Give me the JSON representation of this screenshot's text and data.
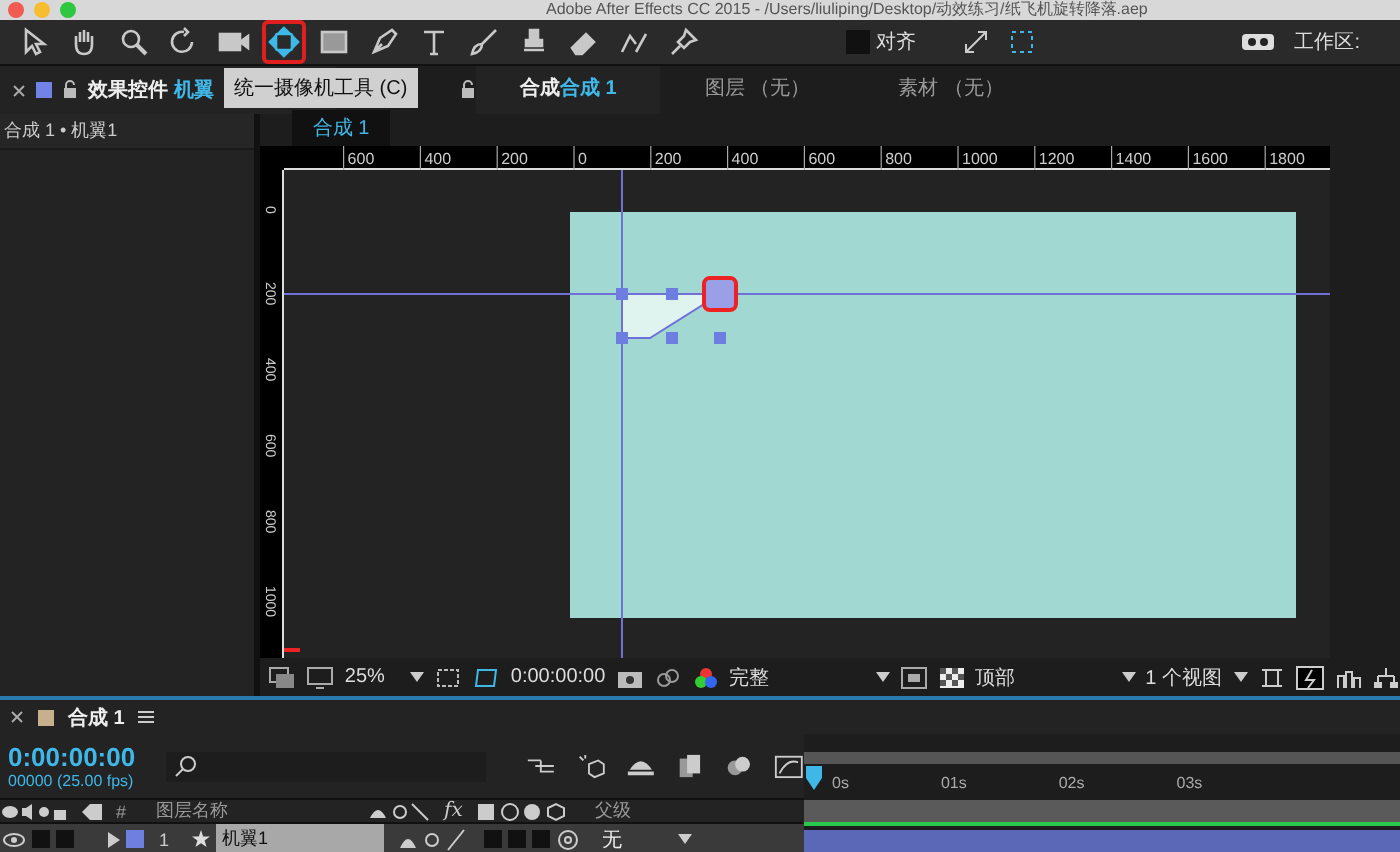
{
  "window": {
    "title": "Adobe After Effects CC 2015 - /Users/liuliping/Desktop/动效练习/纸飞机旋转降落.aep"
  },
  "toolbar": {
    "tools": [
      {
        "kind": "arrow",
        "selected": false
      },
      {
        "kind": "hand",
        "selected": false
      },
      {
        "kind": "zoom",
        "selected": false
      },
      {
        "kind": "rotate",
        "selected": false
      },
      {
        "kind": "camera",
        "selected": false
      },
      {
        "kind": "orbit",
        "selected": true
      },
      {
        "kind": "rect",
        "selected": false
      },
      {
        "kind": "pen",
        "selected": false
      },
      {
        "kind": "text",
        "selected": false
      },
      {
        "kind": "brush",
        "selected": false
      },
      {
        "kind": "stamp",
        "selected": false
      },
      {
        "kind": "eraser",
        "selected": false
      },
      {
        "kind": "roto",
        "selected": false
      },
      {
        "kind": "pin",
        "selected": false
      }
    ],
    "tooltip": "统一摄像机工具 (C)",
    "align_label": "对齐",
    "align_checked": false,
    "workspace_label": "工作区:"
  },
  "left_panel": {
    "tab_label": "效果控件",
    "tab_target": "机翼",
    "breadcrumb": "合成 1 • 机翼1"
  },
  "viewer_tabs": [
    {
      "label": "合成",
      "target": "合成 1",
      "selected": true
    },
    {
      "label": "图层 （无）",
      "selected": false
    },
    {
      "label": "素材 （无）",
      "selected": false
    }
  ],
  "comp_tab": "合成 1",
  "ruler": {
    "horizontal": [
      "600",
      "400",
      "200",
      "0",
      "200",
      "400",
      "600",
      "800",
      "1000",
      "1200",
      "1400",
      "1600",
      "1800"
    ],
    "vertical": [
      "0",
      "200",
      "400",
      "600",
      "800",
      "1000"
    ]
  },
  "viewer_bar": {
    "zoom": "25%",
    "time": "0:00:00:00",
    "resolution": "完整",
    "view": "顶部",
    "layout": "1 个视图"
  },
  "timeline": {
    "tab": "合成 1",
    "timecode": "0:00:00:00",
    "frames": "00000 (25.00 fps)",
    "ticks": [
      "0s",
      "01s",
      "02s",
      "03s"
    ],
    "columns": {
      "effects": "fx",
      "number": "#",
      "name": "图层名称",
      "parent": "父级"
    },
    "layers": [
      {
        "number": "1",
        "name": "机翼1",
        "parent": "无",
        "selected": true,
        "color": "#6f7fe0"
      }
    ]
  }
}
